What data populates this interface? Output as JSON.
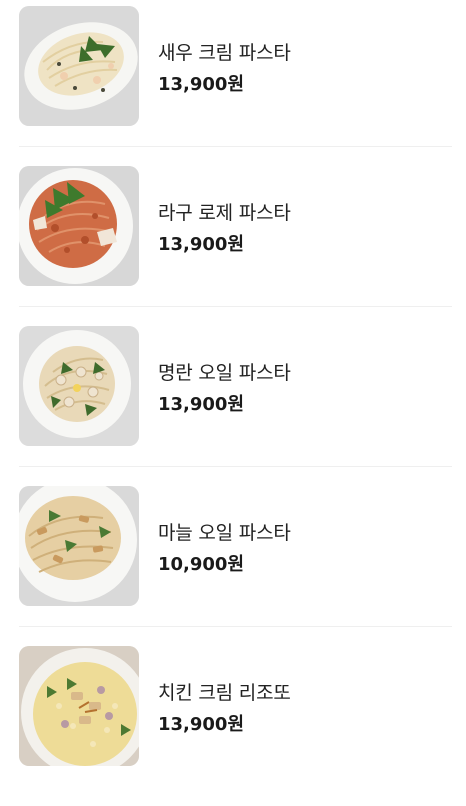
{
  "menu": {
    "items": [
      {
        "name": "새우 크림 파스타",
        "price": "13,900원",
        "image": "shrimp-cream-pasta-photo"
      },
      {
        "name": "라구 로제 파스타",
        "price": "13,900원",
        "image": "ragu-rose-pasta-photo"
      },
      {
        "name": "명란 오일 파스타",
        "price": "13,900원",
        "image": "pollack-roe-oil-pasta-photo"
      },
      {
        "name": "마늘 오일 파스타",
        "price": "10,900원",
        "image": "garlic-oil-pasta-photo"
      },
      {
        "name": "치킨 크림 리조또",
        "price": "13,900원",
        "image": "chicken-cream-risotto-photo"
      }
    ]
  },
  "colors": {
    "text": "#222222",
    "divider": "#efefef",
    "background": "#ffffff"
  }
}
